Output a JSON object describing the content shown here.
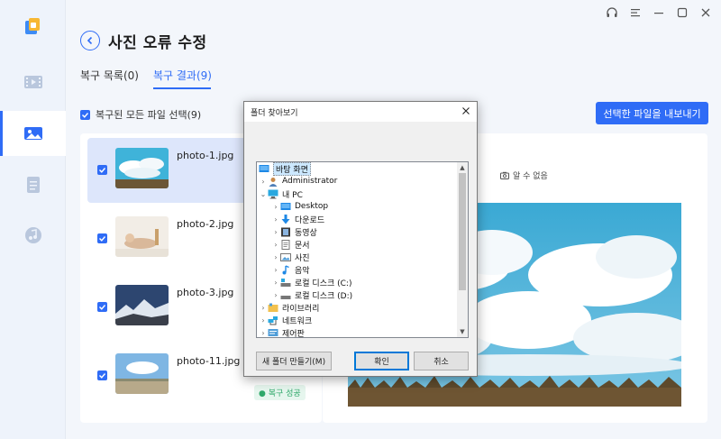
{
  "window": {
    "controls": [
      "headset-icon",
      "menu-icon",
      "minimize-icon",
      "maximize-icon",
      "close-icon"
    ]
  },
  "sidebar": {
    "items": [
      {
        "name": "video-icon",
        "active": false
      },
      {
        "name": "photo-icon",
        "active": true
      },
      {
        "name": "document-icon",
        "active": false
      },
      {
        "name": "music-icon",
        "active": false
      }
    ]
  },
  "header": {
    "title": "사진 오류 수정",
    "tabs": [
      {
        "label": "복구 목록(0)"
      },
      {
        "label": "복구 결과(9)"
      }
    ]
  },
  "toolbar": {
    "select_all_label": "복구된 모든 파일 선택(9)",
    "export_label": "선택한 파일을 내보내기"
  },
  "files": [
    {
      "name": "photo-1.jpg"
    },
    {
      "name": "photo-2.jpg"
    },
    {
      "name": "photo-3.jpg"
    },
    {
      "name": "photo-11.jpg"
    }
  ],
  "status_badge": "● 복구 성공",
  "preview": {
    "unknown_label": "알 수 없음"
  },
  "dialog": {
    "title": "폴더 찾아보기",
    "tree": [
      {
        "label": "바탕 화면",
        "icon": "desktop-folder-icon",
        "level": 0,
        "selected": true
      },
      {
        "label": "Administrator",
        "icon": "user-icon",
        "level": 0
      },
      {
        "label": "내 PC",
        "icon": "pc-icon",
        "level": 0
      },
      {
        "label": "Desktop",
        "icon": "desktop-folder-icon",
        "level": 1
      },
      {
        "label": "다운로드",
        "icon": "download-icon",
        "level": 1
      },
      {
        "label": "동영상",
        "icon": "video-folder-icon",
        "level": 1
      },
      {
        "label": "문서",
        "icon": "documents-icon",
        "level": 1
      },
      {
        "label": "사진",
        "icon": "pictures-icon",
        "level": 1
      },
      {
        "label": "음악",
        "icon": "music-folder-icon",
        "level": 1
      },
      {
        "label": "로컬 디스크 (C:)",
        "icon": "drive-icon",
        "level": 1
      },
      {
        "label": "로컬 디스크 (D:)",
        "icon": "drive-icon",
        "level": 1
      },
      {
        "label": "라이브러리",
        "icon": "library-icon",
        "level": 0
      },
      {
        "label": "네트워크",
        "icon": "network-icon",
        "level": 0
      },
      {
        "label": "제어판",
        "icon": "control-panel-icon",
        "level": 0
      }
    ],
    "new_folder_label": "새 폴더 만들기(M)",
    "ok_label": "확인",
    "cancel_label": "취소"
  },
  "colors": {
    "accent": "#2f6cf6",
    "success": "#2fa86a"
  }
}
